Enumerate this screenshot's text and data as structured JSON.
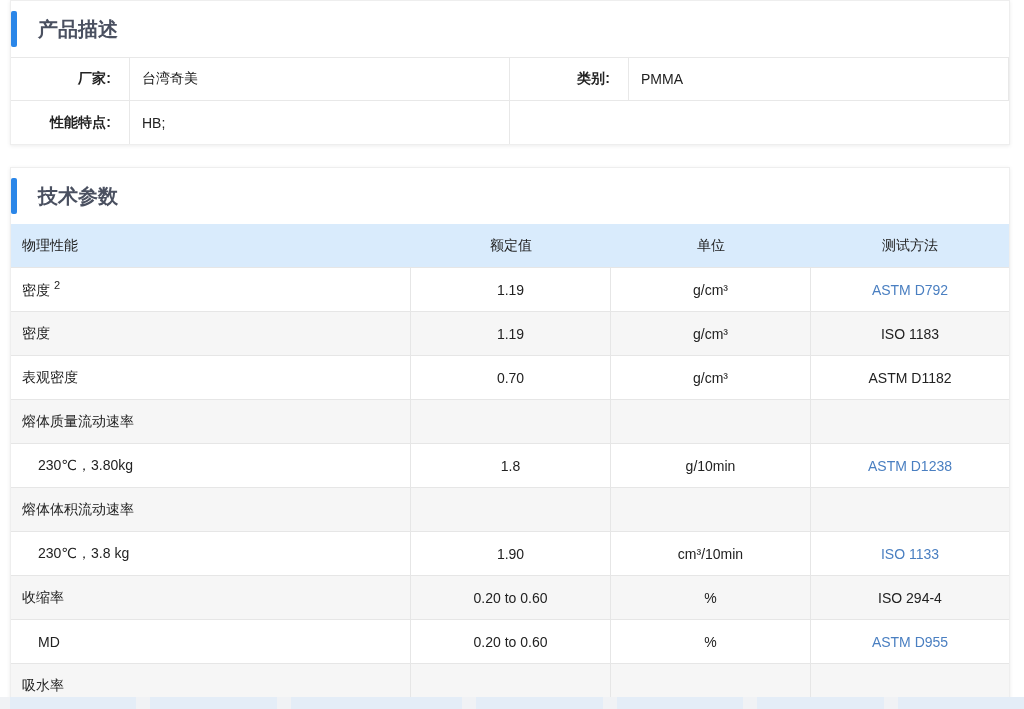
{
  "product_description": {
    "title": "产品描述",
    "fields": [
      {
        "label": "厂家:",
        "value": "台湾奇美"
      },
      {
        "label": "类别:",
        "value": "PMMA"
      },
      {
        "label": "性能特点:",
        "value": "HB;"
      }
    ]
  },
  "technical_parameters": {
    "title": "技术参数",
    "columns": [
      "物理性能",
      "额定值",
      "单位",
      "测试方法"
    ],
    "rows": [
      {
        "kind": "item",
        "property": "密度 $^{2}$",
        "value": "1.19",
        "unit": "g/cm³",
        "method": "ASTM D792",
        "method_link": true
      },
      {
        "kind": "item",
        "property": "密度",
        "value": "1.19",
        "unit": "g/cm³",
        "method": "ISO 1183",
        "method_link": false
      },
      {
        "kind": "item",
        "property": "表观密度",
        "value": "0.70",
        "unit": "g/cm³",
        "method": "ASTM D1182",
        "method_link": false
      },
      {
        "kind": "group",
        "property": "熔体质量流动速率"
      },
      {
        "kind": "sub",
        "property": "230℃，3.80kg",
        "value": "1.8",
        "unit": "g/10min",
        "method": "ASTM D1238",
        "method_link": true
      },
      {
        "kind": "group",
        "property": "熔体体积流动速率"
      },
      {
        "kind": "sub",
        "property": "230℃，3.8 kg",
        "value": "1.90",
        "unit": "cm³/10min",
        "method": "ISO 1133",
        "method_link": true
      },
      {
        "kind": "item",
        "property": "收缩率",
        "value": "0.20 to 0.60",
        "unit": "%",
        "method": "ISO 294-4",
        "method_link": false
      },
      {
        "kind": "sub",
        "property": "MD",
        "value": "0.20 to 0.60",
        "unit": "%",
        "method": "ASTM D955",
        "method_link": true
      },
      {
        "kind": "group",
        "property": "吸水率"
      }
    ]
  }
}
